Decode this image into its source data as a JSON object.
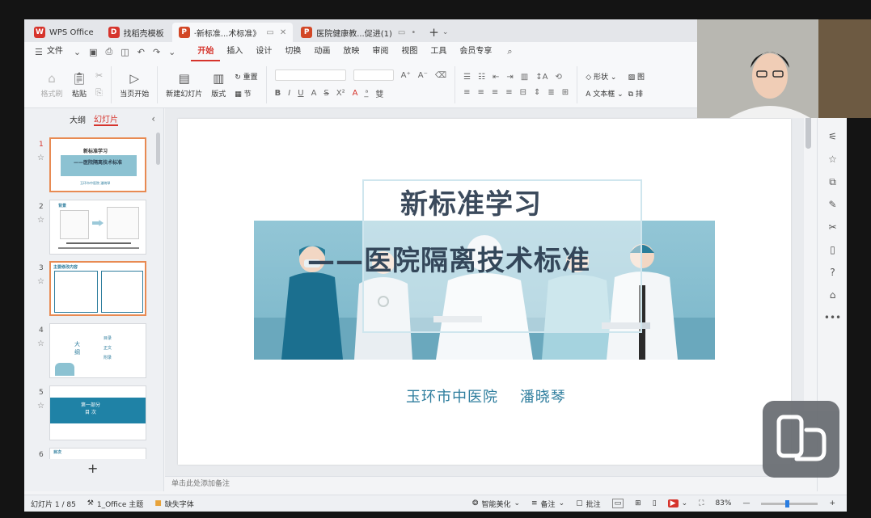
{
  "tabs": [
    {
      "label": "WPS Office",
      "icon": "W",
      "color": "#d6342c"
    },
    {
      "label": "找稻壳模板",
      "icon": "D",
      "color": "#d6342c"
    },
    {
      "label": "·新标准...术标准》",
      "icon": "P",
      "color": "#d24726",
      "active": true
    },
    {
      "label": "医院健康教...促进(1)",
      "icon": "P",
      "color": "#d24726"
    }
  ],
  "menu": {
    "file": "文件",
    "items": [
      "开始",
      "插入",
      "设计",
      "切换",
      "动画",
      "放映",
      "审阅",
      "视图",
      "工具",
      "会员专享"
    ],
    "active": "开始"
  },
  "ribbon": {
    "format_painter": "格式刷",
    "paste": "粘贴",
    "start_from_current": "当页开始",
    "new_slide": "新建幻灯片",
    "layout": "版式",
    "reset": "重置",
    "section": "节",
    "shape": "形状",
    "textbox": "文本框",
    "picture": "图",
    "arrange": "排"
  },
  "left_panel": {
    "tab_outline": "大纲",
    "tab_slides": "幻灯片",
    "thumb1_title": "新标准学习",
    "thumb1_sub": "——医院隔离技术标准",
    "thumb1_author": "玉环市中医院 潘晓琴",
    "thumb2_title": "背景",
    "thumb3_title": "主要修改内容",
    "thumb4_big": "大纲",
    "thumb4_items": [
      "目录",
      "正文",
      "附录"
    ],
    "thumb5_text": "第一部分\n目 次",
    "thumb6_title": "目次",
    "slide_numbers": [
      "1",
      "2",
      "3",
      "4",
      "5",
      "6"
    ]
  },
  "slide": {
    "title": "新标准学习",
    "subtitle": "——医院隔离技术标准",
    "author": "玉环市中医院    潘晓琴"
  },
  "notes_placeholder": "单击此处添加备注",
  "status": {
    "slide_count": "幻灯片 1 / 85",
    "theme": "1_Office 主题",
    "missing_font": "缺失字体",
    "smart_beautify": "智能美化",
    "notes": "备注",
    "comments": "批注",
    "zoom": "83%"
  },
  "colors": {
    "accent": "#d6342c",
    "slide_teal": "#2f7e9e"
  }
}
